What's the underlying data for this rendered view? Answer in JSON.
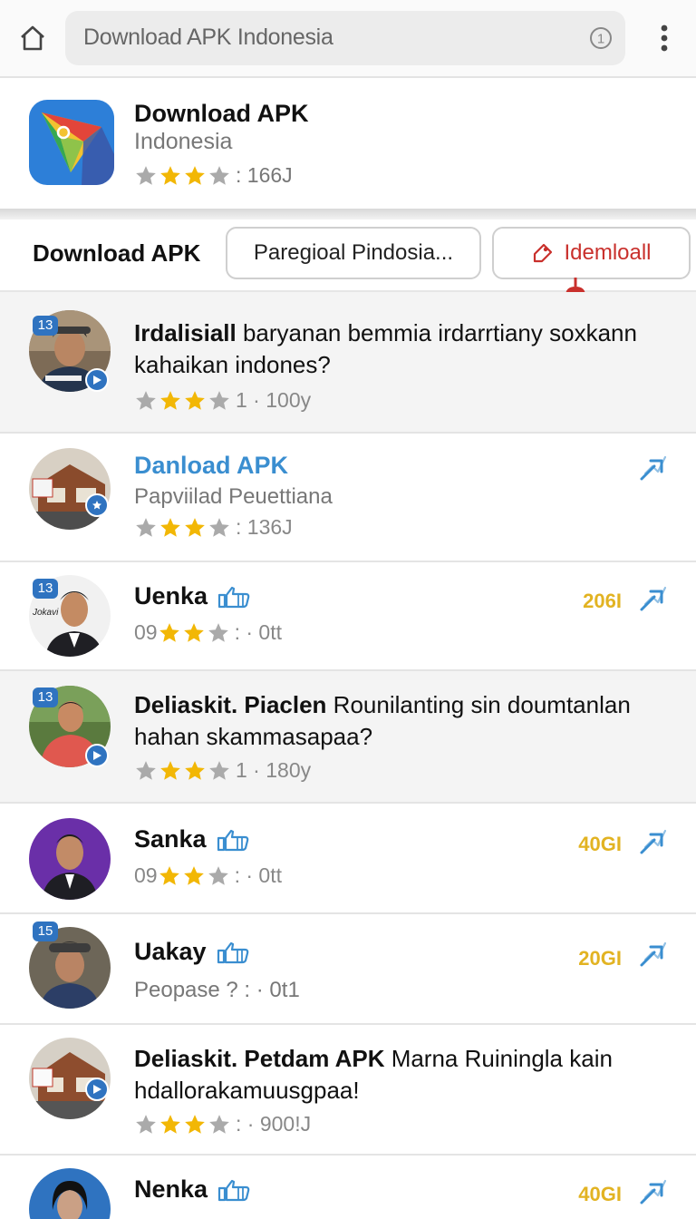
{
  "browser": {
    "url_text": "Download APK Indonesia"
  },
  "app": {
    "name": "Download APK",
    "subtitle": "Indonesia",
    "rating_text": ": 166J"
  },
  "filter": {
    "title": "Download APK",
    "chip_left": "Paregioal Pindosia...",
    "chip_right": "Idemloall"
  },
  "list": [
    {
      "badge": "13",
      "title_bold": "Irdalisiall",
      "title_rest": " baryanan bemmia irdarrtiany soxkann kahaikan indones?",
      "rating_text": "1 · 100y"
    },
    {
      "name": "Danload APK",
      "subtitle": "Papviilad Peuettiana",
      "rating_text": ": 136J"
    },
    {
      "badge": "13",
      "name": "Uenka",
      "meta_prefix": "09",
      "rating_text": ": · 0tt",
      "count": "206I"
    },
    {
      "badge": "13",
      "title_bold": "Deliaskit. Piaclen",
      "title_rest": " Rounilanting sin doumtanlan hahan skammasapaa?",
      "rating_text": "1 · 180y"
    },
    {
      "name": "Sanka",
      "meta_prefix": "09",
      "rating_text": ": · 0tt",
      "count": "40GI"
    },
    {
      "badge": "15",
      "name": "Uakay",
      "subtitle": "Peopase ? : · 0t1",
      "count": "20GI"
    },
    {
      "title_bold": "Deliaskit. Petdam APK",
      "title_rest": " Marna Ruiningla kain hdallorakamuusgpaa!",
      "rating_text": ": · 900!J"
    },
    {
      "name": "Nenka",
      "count": "40GI"
    }
  ],
  "colors": {
    "accent_blue": "#2f73c0",
    "link_blue": "#3a8ed0",
    "star_gold": "#f2b705",
    "count_gold": "#e2b322",
    "chip_red": "#c9302c"
  },
  "icons": [
    "home-icon",
    "info-icon",
    "more-vert-icon",
    "star-icon",
    "thumbs-up-icon",
    "share-icon",
    "play-icon",
    "pin-icon"
  ]
}
